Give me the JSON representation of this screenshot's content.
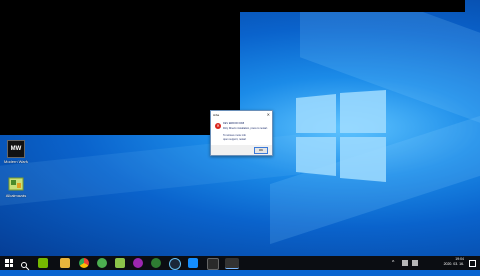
{
  "desktop": {
    "icons": [
      {
        "label": "MW",
        "caption": "Modern Warfare"
      },
      {
        "label": "",
        "caption": "Alkalmazás"
      }
    ]
  },
  "dialog": {
    "title": "Hiba",
    "lines": [
      "DEV ERROR 6068",
      "Dirty Directx installation, press to restart.",
      "To retrieve more info",
      "open support, restart"
    ],
    "ok_label": "OK"
  },
  "taskbar": {
    "apps": [
      "search-icon",
      "nvidia-icon",
      "explorer-icon",
      "chrome-icon",
      "xbox-icon",
      "app-icon",
      "game-icon",
      "xbox-icon",
      "steam-icon",
      "battlenet-icon",
      "desktop-icon",
      "mw-icon"
    ],
    "active_app": "mw-icon"
  },
  "tray": {
    "time": "19:04",
    "date": "2020. 03. 16."
  },
  "colors": {
    "wallpaper": "#0a63cc",
    "taskbar": "#0b0d12",
    "error": "#d9231b"
  }
}
